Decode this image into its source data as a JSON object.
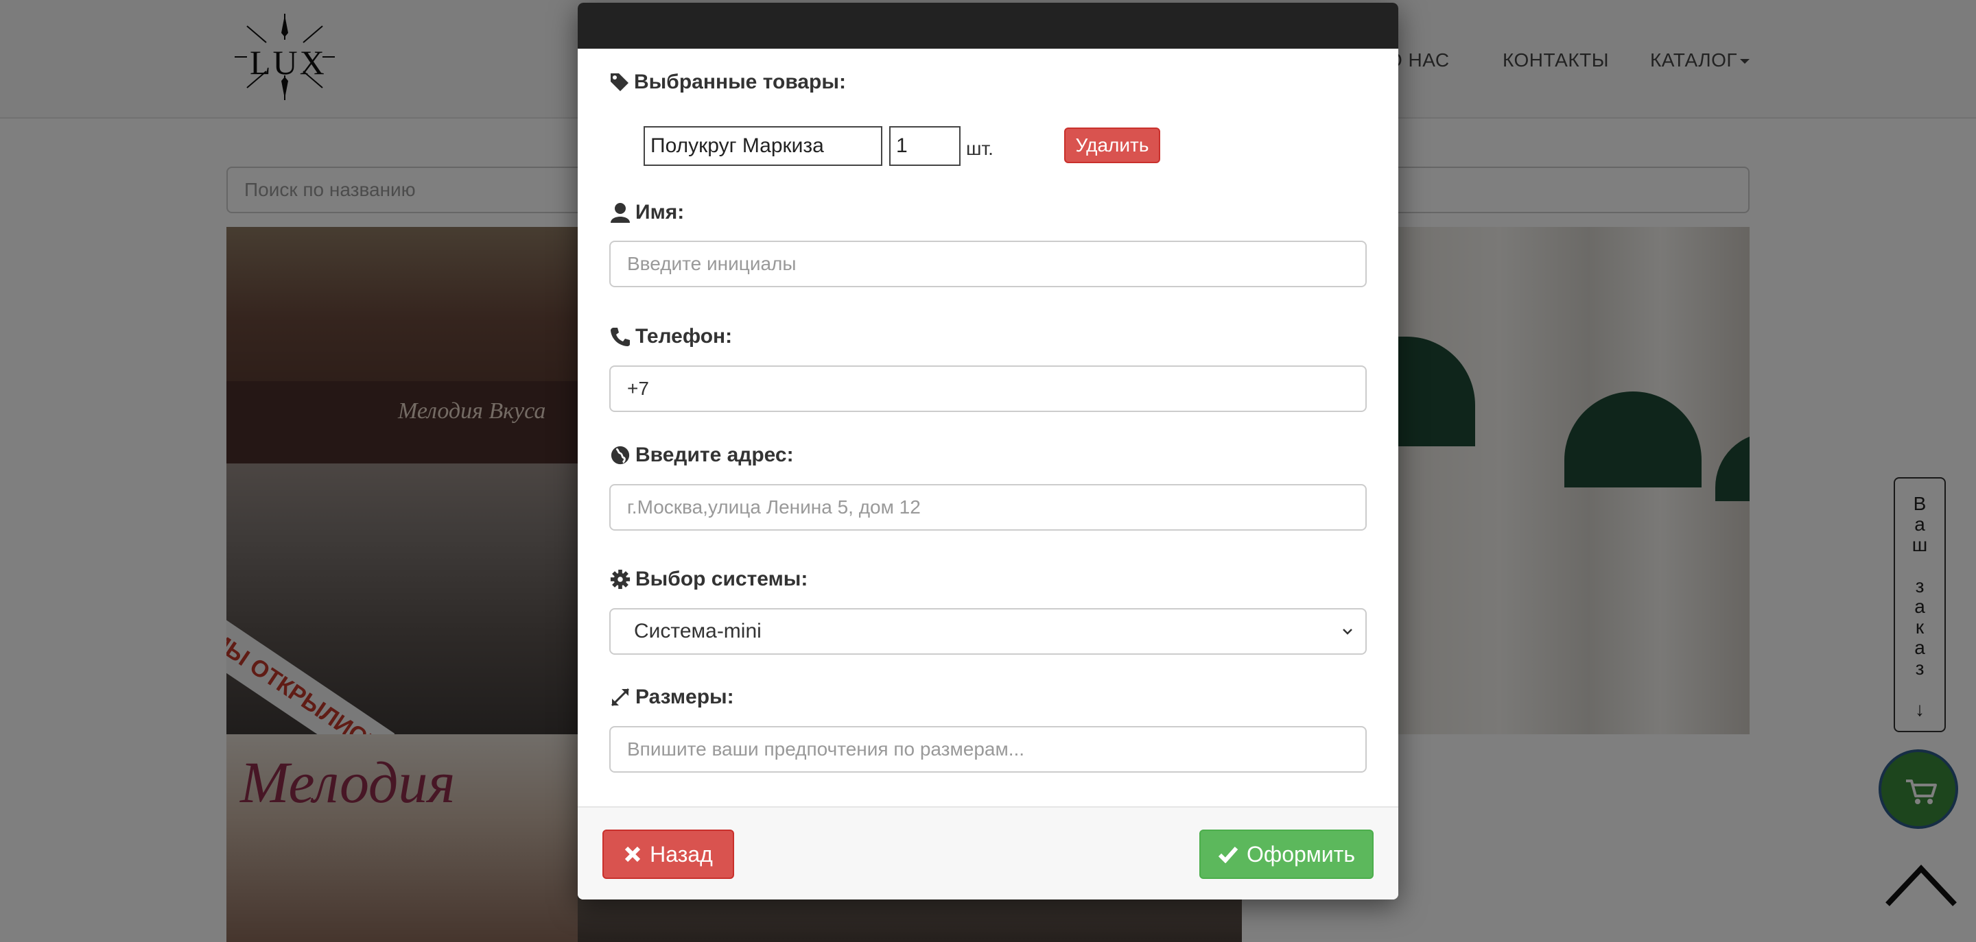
{
  "nav": {
    "logo_text": "LUX",
    "about": "О НАС",
    "contacts": "КОНТАКТЫ",
    "catalog": "КАТАЛОГ"
  },
  "search": {
    "placeholder": "Поиск по названию"
  },
  "photos": {
    "left_sign": "Мелодия Вкуса",
    "left_banner": "МЫ ОТКРЫЛИСЬ",
    "bottom_script": "Мелодия"
  },
  "order_tab": {
    "letters": [
      "В",
      "а",
      "ш",
      "",
      "з",
      "а",
      "к",
      "а",
      "з",
      "",
      "↓"
    ]
  },
  "colors": {
    "danger": "#d9534f",
    "success": "#5cb85c",
    "modal_header": "#222222",
    "cart_button": "#3a8a3a"
  },
  "modal": {
    "selected_products_label": "Выбранные товары:",
    "products": [
      {
        "name": "Полукруг Маркиза",
        "quantity": "1",
        "unit": "шт.",
        "delete_label": "Удалить"
      }
    ],
    "name": {
      "label": "Имя:",
      "placeholder": "Введите инициалы",
      "icon": "user-icon"
    },
    "phone": {
      "label": "Телефон:",
      "value": "+7",
      "icon": "phone-icon"
    },
    "address": {
      "label": "Введите адрес:",
      "placeholder": "г.Москва,улица Ленина 5, дом 12",
      "icon": "globe-icon"
    },
    "system": {
      "label": "Выбор системы:",
      "selected": "Система-mini",
      "icon": "gear-icon"
    },
    "sizes": {
      "label": "Размеры:",
      "placeholder": "Впишите ваши предпочтения по размерам...",
      "icon": "resize-icon"
    },
    "back_label": "Назад",
    "submit_label": "Оформить"
  }
}
